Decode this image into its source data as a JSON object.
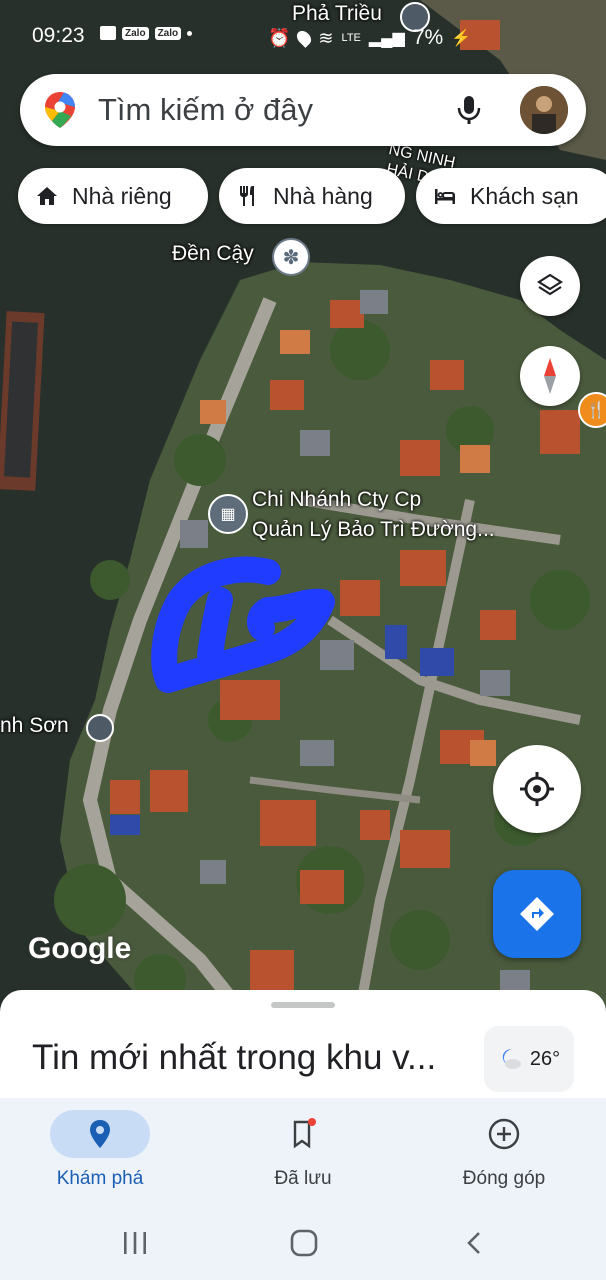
{
  "status_bar": {
    "time": "09:23",
    "apps": [
      "Zalo",
      "Zalo"
    ],
    "network": "LTE",
    "battery": "7%"
  },
  "search": {
    "placeholder": "Tìm kiếm ở đây"
  },
  "chips": [
    {
      "label": "Nhà riêng",
      "icon": "home-icon"
    },
    {
      "label": "Nhà hàng",
      "icon": "restaurant-icon"
    },
    {
      "label": "Khách sạn",
      "icon": "hotel-icon"
    }
  ],
  "map": {
    "labels": {
      "pha_trieu": "Phả Triều",
      "den_cay": "Đền Cậy",
      "chi_nhanh_line1": "Chi Nhánh Cty Cp",
      "chi_nhanh_line2": "Quản Lý Bảo Trì Đường...",
      "anh_son": "nh Sơn",
      "road": "NG NINH",
      "road2": "HẢI D"
    },
    "attribution": "Google",
    "colors": {
      "annotation": "#1f3cff",
      "accent": "#1a73e8"
    }
  },
  "sheet": {
    "title": "Tin mới nhất trong khu v...",
    "weather": "26°"
  },
  "bottom_nav": [
    {
      "label": "Khám phá",
      "icon": "explore-pin-icon",
      "active": true
    },
    {
      "label": "Đã lưu",
      "icon": "bookmark-icon",
      "active": false
    },
    {
      "label": "Đóng góp",
      "icon": "add-circle-icon",
      "active": false
    }
  ]
}
